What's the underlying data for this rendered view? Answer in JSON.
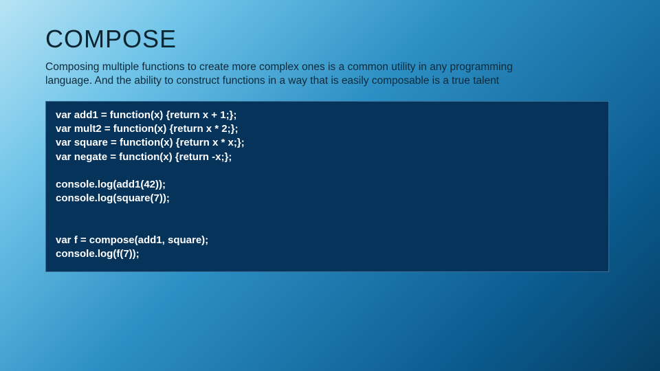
{
  "title": "COMPOSE",
  "description": "Composing multiple functions to create more complex ones is a common utility in any programming language. And the ability to construct functions in a way that is easily composable is a true talent",
  "code": "var add1 = function(x) {return x + 1;};\nvar mult2 = function(x) {return x * 2;};\nvar square = function(x) {return x * x;};\nvar negate = function(x) {return -x;};\n\nconsole.log(add1(42));\nconsole.log(square(7));\n\n\nvar f = compose(add1, square);\nconsole.log(f(7));"
}
